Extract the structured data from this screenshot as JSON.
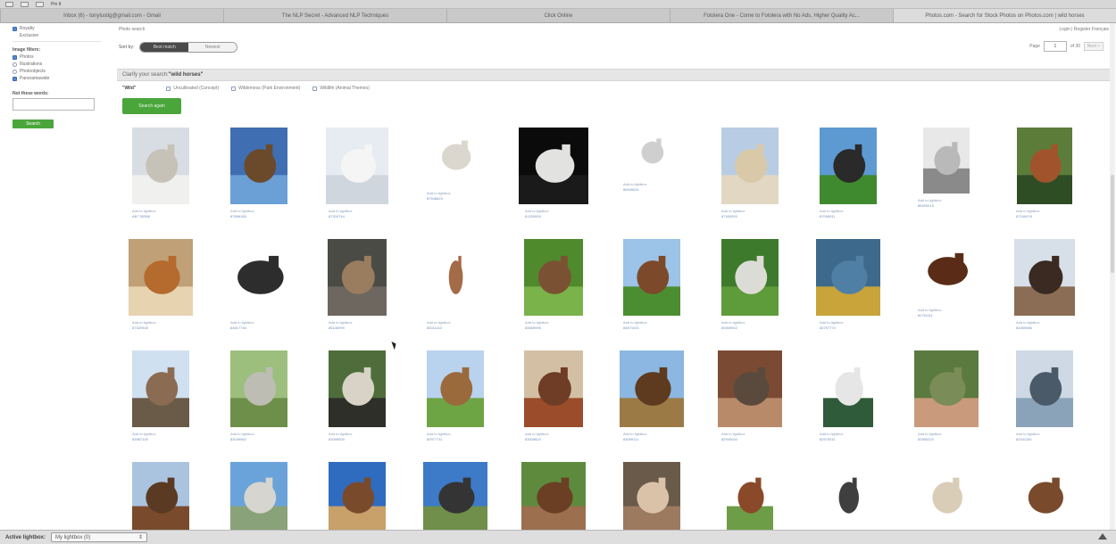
{
  "toolbar": {
    "label": "Pin It"
  },
  "tabs": [
    "Inbox (6) - tonylustig@gmail.com - Gmail",
    "The NLP Secret - Advanced NLP Techniques",
    "Click Online",
    "Fotolera One - Come to Fotolera with No Ads, Higher Quality Ac...",
    "Photos.com - Search for Stock Photos on Photos.com | wild horses"
  ],
  "sidebar": {
    "top_checks": [
      "Royalty",
      "Exclusive"
    ],
    "image_filters_heading": "Image filters:",
    "image_filters": [
      {
        "label": "Photos",
        "checked": true
      },
      {
        "label": "Illustrations",
        "checked": false
      },
      {
        "label": "Photoobjects",
        "checked": false
      },
      {
        "label": "Panoramawide",
        "checked": true
      }
    ],
    "not_these_heading": "Not these words:",
    "search_label": "Search"
  },
  "main": {
    "crumb": "Photo search",
    "top_right": "Login | Register  Français",
    "sort_label": "Sort by:",
    "sort_options": [
      "Best match",
      "Newest"
    ],
    "page_label": "Page",
    "page_value": "1",
    "page_of": "of 30",
    "next_label": "Next >",
    "clarify_prefix": "Clarify your search: ",
    "clarify_term": "\"wild horses\"",
    "meanings_term": "\"Wild\"",
    "meanings": [
      "Uncultivated (Concept)",
      "Wilderness (Park Environment)",
      "Wildlife (Animal Themes)"
    ],
    "search_again": "Search again"
  },
  "photos": [
    {
      "c1": "Add to lightbox",
      "c2": "AB7 55388"
    },
    {
      "c1": "Add to lightbox",
      "c2": "87696185"
    },
    {
      "c1": "Add to lightbox",
      "c2": "87326744"
    },
    {
      "c1": "Add to lightbox",
      "c2": "87548823"
    },
    {
      "c1": "Add to lightbox",
      "c2": "81200000"
    },
    {
      "c1": "Add to lightbox",
      "c2": "86549001"
    },
    {
      "c1": "Add to lightbox",
      "c2": "87490000"
    },
    {
      "c1": "Add to lightbox",
      "c2": "87096511"
    },
    {
      "c1": "Add to lightbox",
      "c2": "86200015"
    },
    {
      "c1": "Add to lightbox",
      "c2": "87150478"
    },
    {
      "c1": "Add to lightbox",
      "c2": "87320928"
    },
    {
      "c1": "Add to lightbox",
      "c2": "84817730"
    },
    {
      "c1": "Add to lightbox",
      "c2": "85146999"
    },
    {
      "c1": "Add to lightbox",
      "c2": "85011110"
    },
    {
      "c1": "Add to lightbox",
      "c2": "84669995"
    },
    {
      "c1": "Add to lightbox",
      "c2": "84671021"
    },
    {
      "c1": "Add to lightbox",
      "c2": "83069902"
    },
    {
      "c1": "Add to lightbox",
      "c2": "84797774"
    },
    {
      "c1": "Add to lightbox",
      "c2": "82761111"
    },
    {
      "c1": "Add to lightbox",
      "c2": "84450986"
    },
    {
      "c1": "Add to lightbox",
      "c2": "83987100"
    },
    {
      "c1": "Add to lightbox",
      "c2": "83049982"
    },
    {
      "c1": "Add to lightbox",
      "c2": "83099000"
    },
    {
      "c1": "Add to lightbox",
      "c2": "82977711"
    },
    {
      "c1": "Add to lightbox",
      "c2": "83009820"
    },
    {
      "c1": "Add to lightbox",
      "c2": "83099111"
    },
    {
      "c1": "Add to lightbox",
      "c2": "82940000"
    },
    {
      "c1": "Add to lightbox",
      "c2": "82970011"
    },
    {
      "c1": "Add to lightbox",
      "c2": "82960220"
    },
    {
      "c1": "Add to lightbox",
      "c2": "82941100"
    },
    {
      "c1": "",
      "c2": ""
    },
    {
      "c1": "",
      "c2": ""
    },
    {
      "c1": "",
      "c2": ""
    },
    {
      "c1": "",
      "c2": ""
    },
    {
      "c1": "",
      "c2": ""
    },
    {
      "c1": "",
      "c2": ""
    },
    {
      "c1": "",
      "c2": ""
    },
    {
      "c1": "",
      "c2": ""
    },
    {
      "c1": "",
      "c2": ""
    },
    {
      "c1": "",
      "c2": ""
    }
  ],
  "bottom": {
    "active_label": "Active lightbox:",
    "lightbox_value": "My lightbox (0)"
  },
  "colors": {
    "accent_green": "#4aa63b",
    "checkbox_blue": "#5a87c9",
    "caption_blue": "#7090b8"
  }
}
